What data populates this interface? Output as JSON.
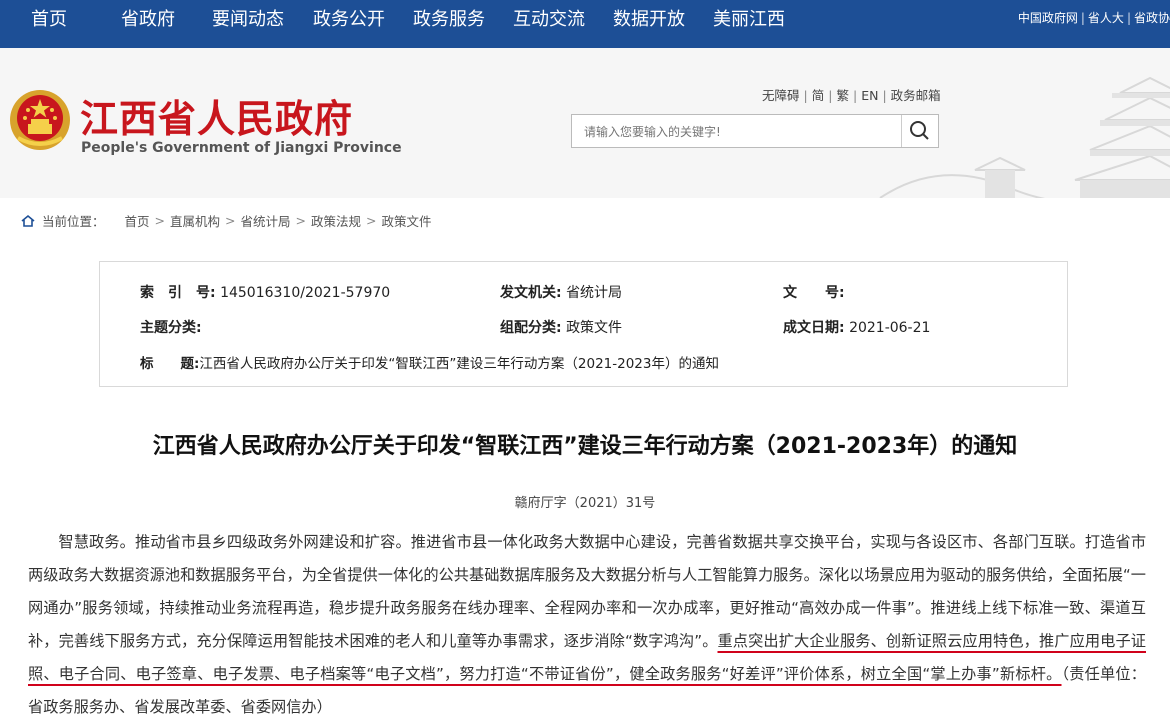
{
  "nav": {
    "items": [
      "首页",
      "省政府",
      "要闻动态",
      "政务公开",
      "政务服务",
      "互动交流",
      "数据开放",
      "美丽江西"
    ],
    "links": [
      "中国政府网",
      "省人大",
      "省政协"
    ]
  },
  "header": {
    "title": "江西省人民政府",
    "subtitle": "People's Government of Jiangxi Province",
    "util_links": [
      "无障碍",
      "简",
      "繁",
      "EN",
      "政务邮箱"
    ],
    "search_placeholder": "请输入您要输入的关键字!"
  },
  "breadcrumb": {
    "label": "当前位置：",
    "items": [
      "首页",
      "直属机构",
      "省统计局",
      "政策法规",
      "政策文件"
    ]
  },
  "meta": {
    "index_key": "索　引　号:",
    "index_val": "145016310/2021-57970",
    "issuer_key": "发文机关:",
    "issuer_val": "省统计局",
    "docno_key": "文　　号:",
    "docno_val": "",
    "topic_key": "主题分类:",
    "topic_val": "",
    "category_key": "组配分类:",
    "category_val": "政策文件",
    "date_key": "成文日期:",
    "date_val": "2021-06-21",
    "title_key": "标　　题:",
    "title_val": "江西省人民政府办公厅关于印发“智联江西”建设三年行动方案（2021-2023年）的通知"
  },
  "doc": {
    "title": "江西省人民政府办公厅关于印发“智联江西”建设三年行动方案（2021-2023年）的通知",
    "number": "赣府厅字（2021）31号",
    "para_plain": "智慧政务。推动省市县乡四级政务外网建设和扩容。推进省市县一体化政务大数据中心建设，完善省数据共享交换平台，实现与各设区市、各部门互联。打造省市两级政务大数据资源池和数据服务平台，为全省提供一体化的公共基础数据库服务及大数据分析与人工智能算力服务。深化以场景应用为驱动的服务供给，全面拓展“一网通办”服务领域，持续推动业务流程再造，稳步提升政务服务在线办理率、全程网办率和一次办成率，更好推动“高效办成一件事”。推进线上线下标准一致、渠道互补，完善线下服务方式，充分保障运用智能技术困难的老人和儿童等办事需求，逐步消除“数字鸿沟”。",
    "para_underlined": "重点突出扩大企业服务、创新证照云应用特色，推广应用电子证照、电子合同、电子签章、电子发票、电子档案等“电子文档”，努力打造“不带证省份”，健全政务服务“好差评”评价体系，树立全国“掌上办事”新标杆。",
    "para_tail": "（责任单位：省政务服务办、省发展改革委、省委网信办）"
  },
  "colors": {
    "nav_bg": "#1d4f96",
    "title_red": "#c8161d",
    "underline_red": "#d0021b"
  }
}
